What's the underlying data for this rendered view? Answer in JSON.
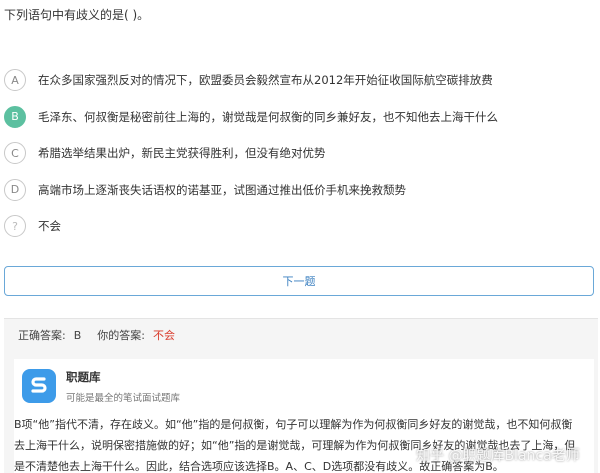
{
  "question": "下列语句中有歧义的是( )。",
  "options": [
    {
      "letter": "A",
      "text": "在众多国家强烈反对的情况下，欧盟委员会毅然宣布从2012年开始征收国际航空碳排放费",
      "state": "normal"
    },
    {
      "letter": "B",
      "text": "毛泽东、何叔衡是秘密前往上海的，谢觉哉是何叔衡的同乡兼好友，也不知他去上海干什么",
      "state": "correct"
    },
    {
      "letter": "C",
      "text": "希腊选举结果出炉，新民主党获得胜利，但没有绝对优势",
      "state": "normal"
    },
    {
      "letter": "D",
      "text": "高端市场上逐渐丧失话语权的诺基亚，试图通过推出低价手机来挽救颓势",
      "state": "normal"
    },
    {
      "letter": "?",
      "text": "不会",
      "state": "unknown"
    }
  ],
  "next_button": "下一题",
  "answer": {
    "correct_label": "正确答案:",
    "correct_value": "B",
    "your_label": "你的答案:",
    "your_value": "不会"
  },
  "brand": {
    "name": "职题库",
    "tagline": "可能是最全的笔试面试题库"
  },
  "explanation": "B项“他”指代不清，存在歧义。如“他”指的是何叔衡，句子可以理解为作为何叔衡同乡好友的谢觉哉，也不知何叔衡去上海干什么，说明保密措施做的好；如“他”指的是谢觉哉，可理解为作为何叔衡同乡好友的谢觉哉也去了上海，但是不清楚他去上海干什么。因此，结合选项应该选择B。A、C、D选项都没有歧义。故正确答案为B。",
  "watermark": "知乎 @职题库Blanca老师",
  "colors": {
    "correct_badge": "#5cc0a0",
    "button_border": "#6aa8d8",
    "wrong_answer": "#d93a2b",
    "logo_bg": "#3d9be9"
  }
}
